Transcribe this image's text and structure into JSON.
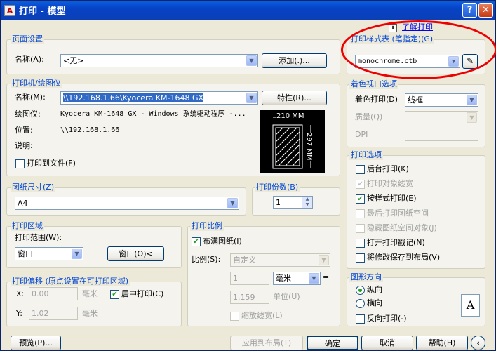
{
  "window": {
    "title": "打印 - 模型",
    "help_label": "?",
    "close_label": "✕",
    "app_icon": "A"
  },
  "page_setup": {
    "group": "页面设置",
    "name_label": "名称(A):",
    "name_value": "<无>",
    "add_button": "添加(.)..."
  },
  "printer": {
    "group": "打印机/绘图仪",
    "name_label": "名称(M):",
    "name_value": "\\\\192.168.1.66\\Kyocera KM-1648 GX",
    "properties_button": "特性(R)...",
    "plotter_label": "绘图仪:",
    "plotter_value": "Kyocera KM-1648 GX - Windows 系统驱动程序 -...",
    "location_label": "位置:",
    "location_value": "\\\\192.168.1.66",
    "desc_label": "说明:",
    "print_to_file": "打印到文件(F)",
    "paper_width": "210 MM",
    "paper_height": "297 MM"
  },
  "paper_size": {
    "group": "图纸尺寸(Z)",
    "value": "A4"
  },
  "copies": {
    "group": "打印份数(B)",
    "value": "1"
  },
  "print_area": {
    "group": "打印区域",
    "range_label": "打印范围(W):",
    "range_value": "窗口",
    "window_button": "窗口(O)<"
  },
  "print_offset": {
    "group": "打印偏移 (原点设置在可打印区域)",
    "x_label": "X:",
    "x_value": "0.00",
    "x_unit": "毫米",
    "y_label": "Y:",
    "y_value": "1.02",
    "y_unit": "毫米",
    "center_label": "居中打印(C)"
  },
  "print_scale": {
    "group": "打印比例",
    "fit_label": "布满图纸(I)",
    "scale_label": "比例(S):",
    "scale_value": "自定义",
    "value1": "1",
    "unit1": "毫米",
    "equals": "=",
    "value2": "1.159",
    "unit2": "单位(U)",
    "lineweight_label": "缩放线宽(L)"
  },
  "plot_style": {
    "help_icon": "i",
    "help_link": "了解打印",
    "group": "打印样式表 (笔指定)(G)",
    "value": "monochrome.ctb"
  },
  "shaded_viewport": {
    "group": "着色视口选项",
    "shade_label": "着色打印(D)",
    "shade_value": "线框",
    "quality_label": "质量(Q)",
    "dpi_label": "DPI"
  },
  "plot_options": {
    "group": "打印选项",
    "items": [
      {
        "label": "后台打印(K)",
        "checked": false,
        "enabled": true
      },
      {
        "label": "打印对象线宽",
        "checked": true,
        "enabled": false
      },
      {
        "label": "按样式打印(E)",
        "checked": true,
        "enabled": true
      },
      {
        "label": "最后打印图纸空间",
        "checked": false,
        "enabled": false
      },
      {
        "label": "隐藏图纸空间对象(J)",
        "checked": false,
        "enabled": false
      },
      {
        "label": "打开打印戳记(N)",
        "checked": false,
        "enabled": true
      },
      {
        "label": "将修改保存到布局(V)",
        "checked": false,
        "enabled": true
      }
    ]
  },
  "orientation": {
    "group": "图形方向",
    "portrait": "纵向",
    "landscape": "横向",
    "reverse": "反向打印(-)",
    "letter": "A"
  },
  "footer": {
    "preview": "预览(P)...",
    "apply": "应用到布局(T)",
    "ok": "确定",
    "cancel": "取消",
    "help": "帮助(H)",
    "expand": "‹"
  }
}
